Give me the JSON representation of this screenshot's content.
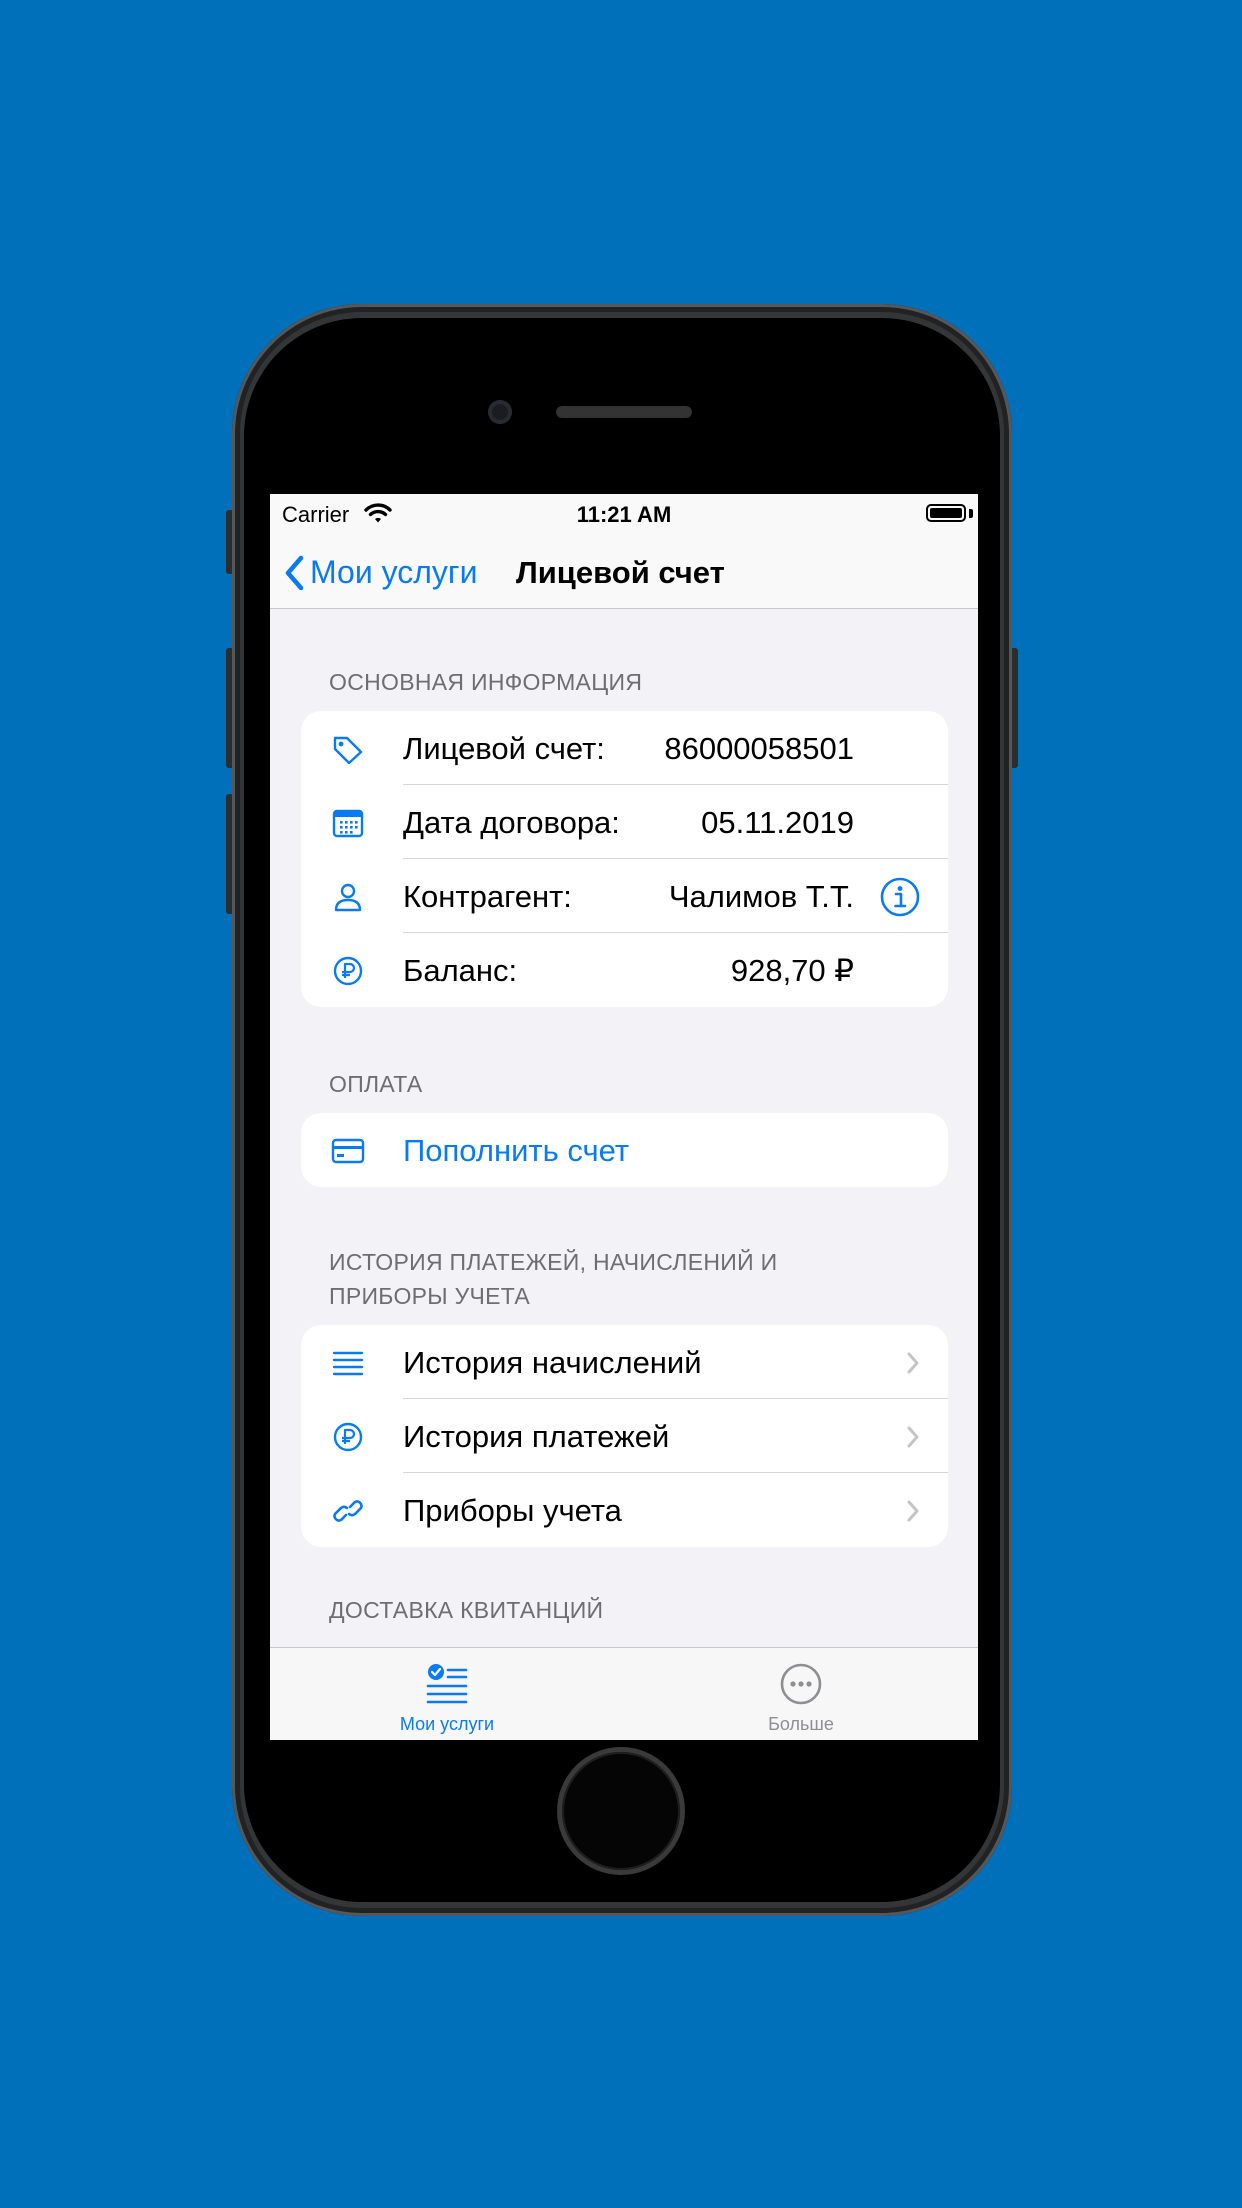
{
  "colors": {
    "background": "#0070BB",
    "accent": "#0A7AF2",
    "inactive": "#8E8E93"
  },
  "status_bar": {
    "carrier": "Carrier",
    "time": "11:21 AM"
  },
  "nav": {
    "back_label": "Мои услуги",
    "title": "Лицевой счет"
  },
  "sections": {
    "main_info": {
      "header": "ОСНОВНАЯ ИНФОРМАЦИЯ",
      "rows": [
        {
          "icon": "tag-icon",
          "label": "Лицевой счет:",
          "value": "86000058501"
        },
        {
          "icon": "calendar-icon",
          "label": "Дата договора:",
          "value": "05.11.2019"
        },
        {
          "icon": "person-icon",
          "label": "Контрагент:",
          "value": "Чалимов Т.Т.",
          "accessory": "info-icon"
        },
        {
          "icon": "ruble-icon",
          "label": "Баланс:",
          "value": "928,70 ₽"
        }
      ]
    },
    "payment": {
      "header": "ОПЛАТА",
      "rows": [
        {
          "icon": "credit-card-icon",
          "label": "Пополнить счет"
        }
      ]
    },
    "history": {
      "header": "ИСТОРИЯ ПЛАТЕЖЕЙ, НАЧИСЛЕНИЙ И ПРИБОРЫ УЧЕТА",
      "rows": [
        {
          "icon": "list-icon",
          "label": "История начислений"
        },
        {
          "icon": "ruble-icon",
          "label": "История платежей"
        },
        {
          "icon": "link-icon",
          "label": "Приборы учета"
        }
      ]
    },
    "delivery": {
      "header": "ДОСТАВКА КВИТАНЦИЙ"
    }
  },
  "tab_bar": {
    "tabs": [
      {
        "icon": "checklist-icon",
        "label": "Мои услуги",
        "active": true
      },
      {
        "icon": "more-icon",
        "label": "Больше",
        "active": false
      }
    ]
  }
}
